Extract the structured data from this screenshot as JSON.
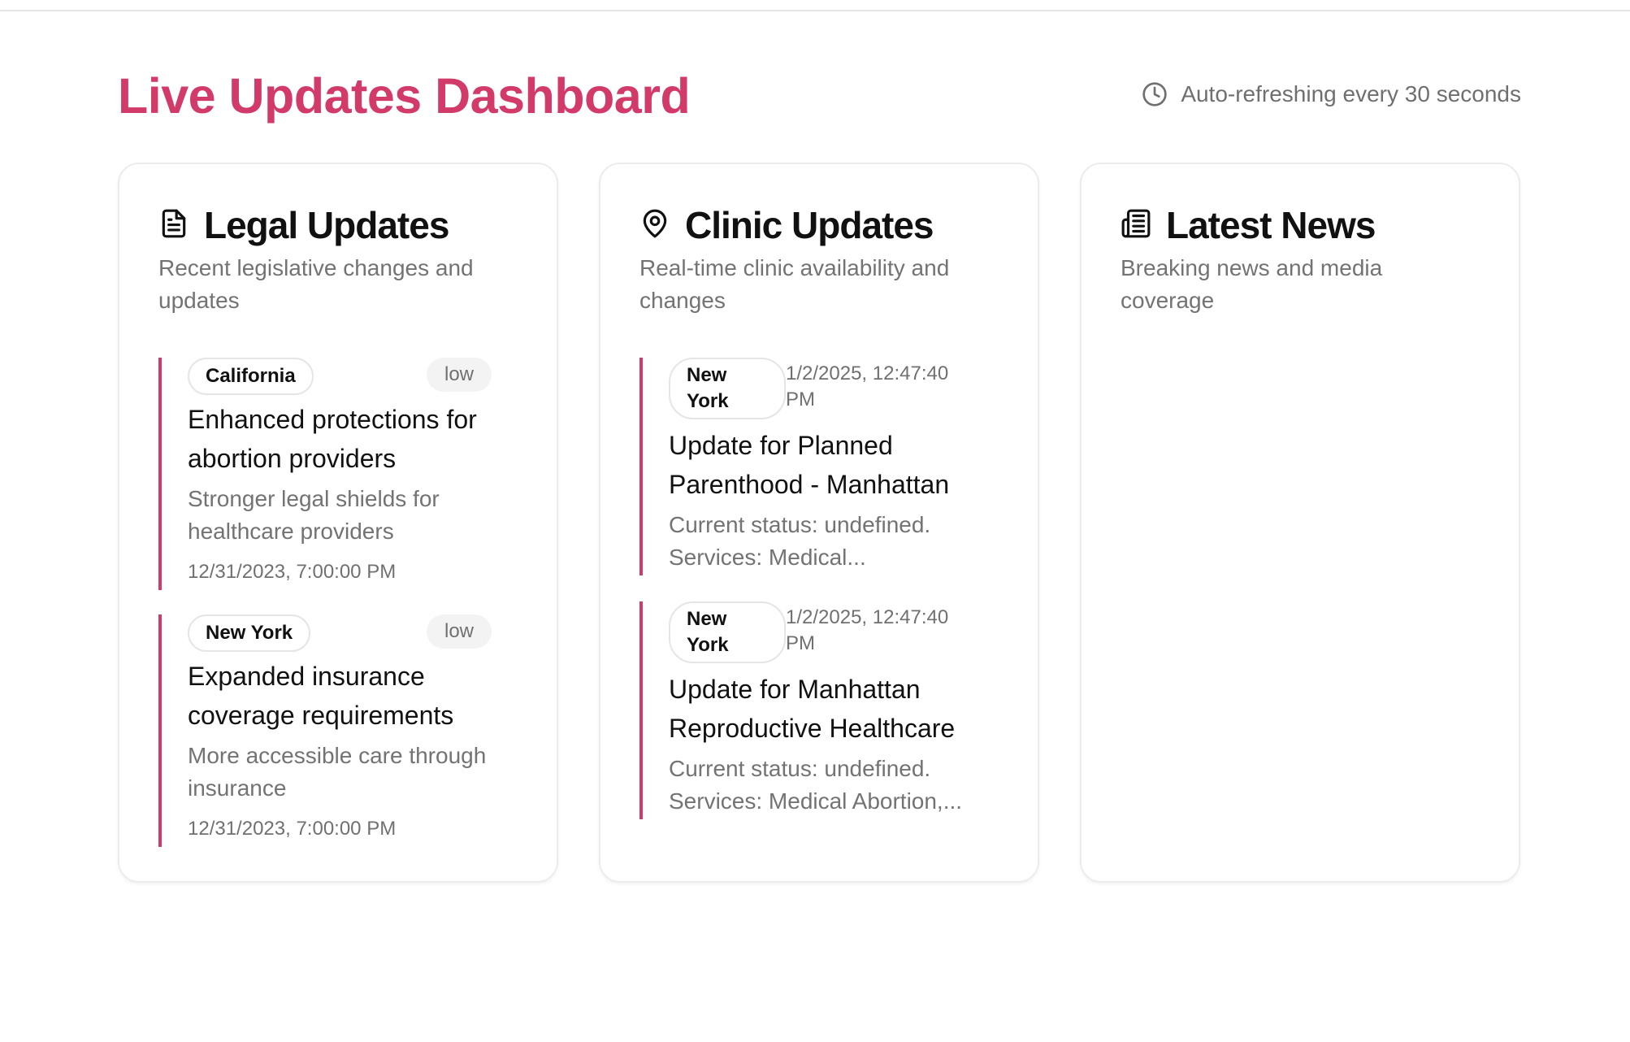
{
  "header": {
    "title": "Live Updates Dashboard",
    "refresh_text": "Auto-refreshing every 30 seconds",
    "refresh_icon": "clock-icon"
  },
  "colors": {
    "accent": "#d23a6a",
    "muted_text": "#737373",
    "border": "#ececec"
  },
  "legal": {
    "icon": "document-icon",
    "title": "Legal Updates",
    "subtitle": "Recent legislative changes and updates",
    "items": [
      {
        "state": "California",
        "priority": "low",
        "title": "Enhanced protections for abortion providers",
        "description": "Stronger legal shields for healthcare providers",
        "date": "12/31/2023, 7:00:00 PM"
      },
      {
        "state": "New York",
        "priority": "low",
        "title": "Expanded insurance coverage requirements",
        "description": "More accessible care through insurance",
        "date": "12/31/2023, 7:00:00 PM"
      }
    ]
  },
  "clinic": {
    "icon": "map-pin-icon",
    "title": "Clinic Updates",
    "subtitle": "Real-time clinic availability and changes",
    "items": [
      {
        "state": "New York",
        "date": "1/2/2025, 12:47:40 PM",
        "title": "Update for Planned Parenthood - Manhattan",
        "description": "Current status: undefined. Services: Medical..."
      },
      {
        "state": "New York",
        "date": "1/2/2025, 12:47:40 PM",
        "title": "Update for Manhattan Reproductive Healthcare",
        "description": "Current status: undefined. Services: Medical Abortion,..."
      }
    ]
  },
  "news": {
    "icon": "newspaper-icon",
    "title": "Latest News",
    "subtitle": "Breaking news and media coverage"
  }
}
